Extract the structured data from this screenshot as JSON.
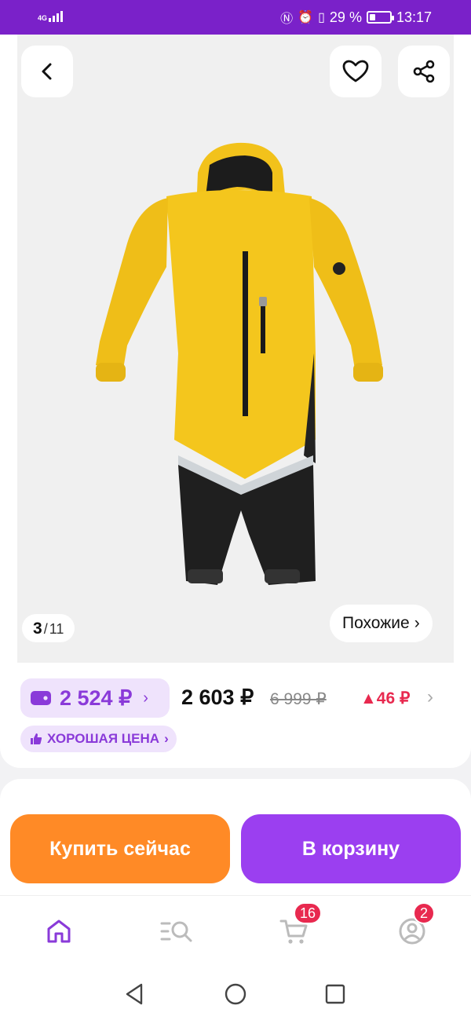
{
  "status_bar": {
    "network": "4G",
    "battery": "29 %",
    "battery_level": 0.29,
    "time": "13:17",
    "icons": [
      "nfc-icon",
      "alarm-icon",
      "vibrate-icon"
    ]
  },
  "gallery": {
    "current": "3",
    "total": "11",
    "similar_label": "Похожие",
    "icons": {
      "back": "back-icon",
      "favorite": "heart-icon",
      "share": "share-icon"
    }
  },
  "price": {
    "wallet_price": "2 524 ₽",
    "price": "2 603 ₽",
    "old_price": "6 999 ₽",
    "delta": "▲46 ₽",
    "good_price_label": "ХОРОШАЯ ЦЕНА"
  },
  "actions": {
    "buy_now": "Купить сейчас",
    "add_to_cart": "В корзину"
  },
  "tabbar": {
    "cart_badge": "16",
    "profile_badge": "2"
  },
  "colors": {
    "brand": "#7a21c9",
    "accent_purple": "#9b3ff0",
    "orange": "#ff8a26",
    "red": "#e8294f"
  }
}
